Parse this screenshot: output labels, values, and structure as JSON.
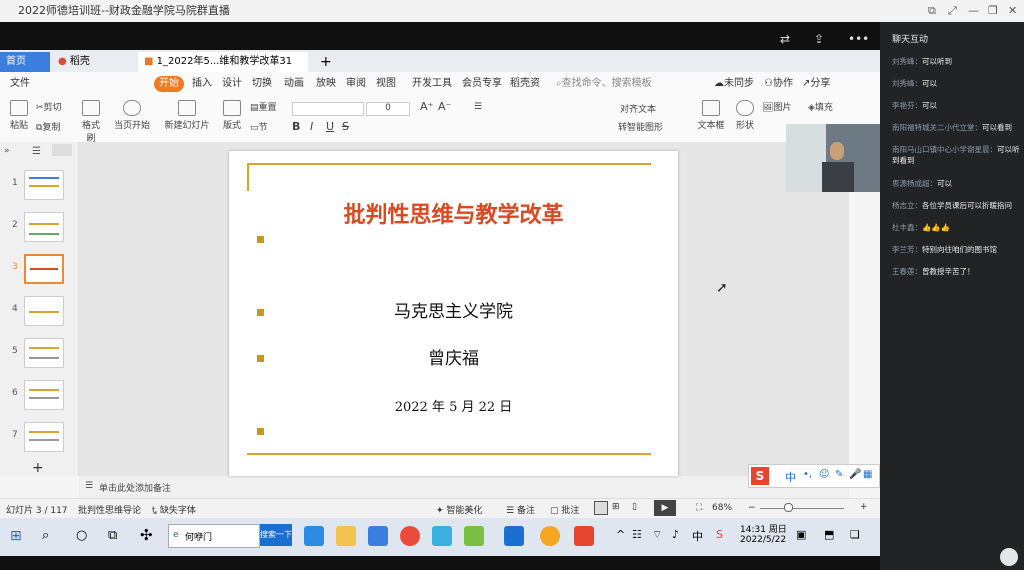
{
  "window": {
    "title": "2022师德培训班--财政金融学院马院群直播"
  },
  "wps": {
    "tabs": [
      {
        "label": "首页"
      },
      {
        "label": "稻壳"
      },
      {
        "label": "1_2022年5...维和教学改革31"
      }
    ],
    "menu": {
      "file": "文件",
      "items": [
        "开始",
        "插入",
        "设计",
        "切换",
        "动画",
        "放映",
        "审阅",
        "视图",
        "开发工具",
        "会员专享",
        "稻壳资"
      ],
      "search_placeholder": "查找命令、搜索模板",
      "unsynced": "未同步",
      "collab": "协作",
      "share": "分享"
    },
    "tools": {
      "paste": "粘贴",
      "cut": "剪切",
      "copy": "复制",
      "format_painter": "格式刷",
      "play_from_current": "当页开始",
      "new_slide": "新建幻灯片",
      "layout": "版式",
      "section": "节",
      "reset": "重置",
      "font_size": "0",
      "text_box": "文本框",
      "shape": "形状",
      "picture": "图片",
      "fill": "填充",
      "align_text": "对齐文本",
      "smart_graphic": "转智能图形"
    },
    "slide_thumbs": [
      "1",
      "2",
      "3",
      "4",
      "5",
      "6",
      "7"
    ],
    "selected_thumb": "3",
    "slide": {
      "title": "批判性思维与教学改革",
      "school": "马克思主义学院",
      "author": "曾庆福",
      "date": "2022 年 5 月 22 日"
    },
    "notes_placeholder": "单击此处添加备注",
    "status": {
      "slide_index": "幻灯片 3 / 117",
      "template": "批判性思维导论",
      "missing_font": "缺失字体",
      "beautify": "智能美化",
      "notes": "备注",
      "comments": "批注",
      "zoom": "68%"
    }
  },
  "chat": {
    "header": "聊天互动",
    "messages": [
      {
        "name": "刘秀峰：",
        "text": "可以听到"
      },
      {
        "name": "刘秀峰：",
        "text": "可以"
      },
      {
        "name": "李艳芬：",
        "text": "可以"
      },
      {
        "name": "南阳福特城关二小代立堂：",
        "text": "可以看到"
      },
      {
        "name": "南阳马山口镇中心小学谢星晨：",
        "text": "可以听到看到"
      },
      {
        "name": "思源杨成超：",
        "text": "可以"
      },
      {
        "name": "杨志立：",
        "text": "各位学员课后可以折暖指问"
      },
      {
        "name": "杜丰鑫：",
        "text": "👍👍👍"
      },
      {
        "name": "李兰芳：",
        "text": "特别向往咱们的图书馆"
      },
      {
        "name": "王春莲：",
        "text": "曾教授辛苦了！"
      }
    ]
  },
  "taskbar": {
    "search_text": "何咿门",
    "search_btn": "搜索一下",
    "time": "14:31 周日",
    "date": "2022/5/22"
  },
  "colors": {
    "slide_title": "#d94a23",
    "accent_orange": "#f07a1f",
    "gold": "#d9a32f"
  }
}
